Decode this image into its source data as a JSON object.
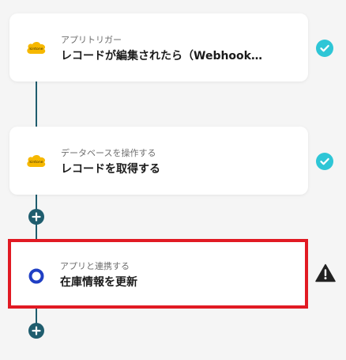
{
  "flow": {
    "steps": [
      {
        "type_label": "アプリトリガー",
        "title": "レコードが編集されたら（Webhook…",
        "app_icon": "kintone-logo",
        "logo_text": "kintone",
        "status": "complete",
        "status_icon": "check-circle-icon"
      },
      {
        "type_label": "データベースを操作する",
        "title": "レコードを取得する",
        "app_icon": "kintone-logo",
        "logo_text": "kintone",
        "status": "complete",
        "status_icon": "check-circle-icon"
      },
      {
        "type_label": "アプリと連携する",
        "title": "在庫情報を更新",
        "app_icon": "app-ring-icon",
        "status": "warning",
        "status_icon": "warning-triangle-icon",
        "highlighted": true
      }
    ],
    "add_step_icon": "plus-icon"
  },
  "colors": {
    "connector": "#1f5d6e",
    "check": "#2ec6d6",
    "highlight_border": "#e11a23",
    "kintone_yellow": "#f6b800",
    "app_ring": "#1f3fc4",
    "warning": "#222222"
  }
}
